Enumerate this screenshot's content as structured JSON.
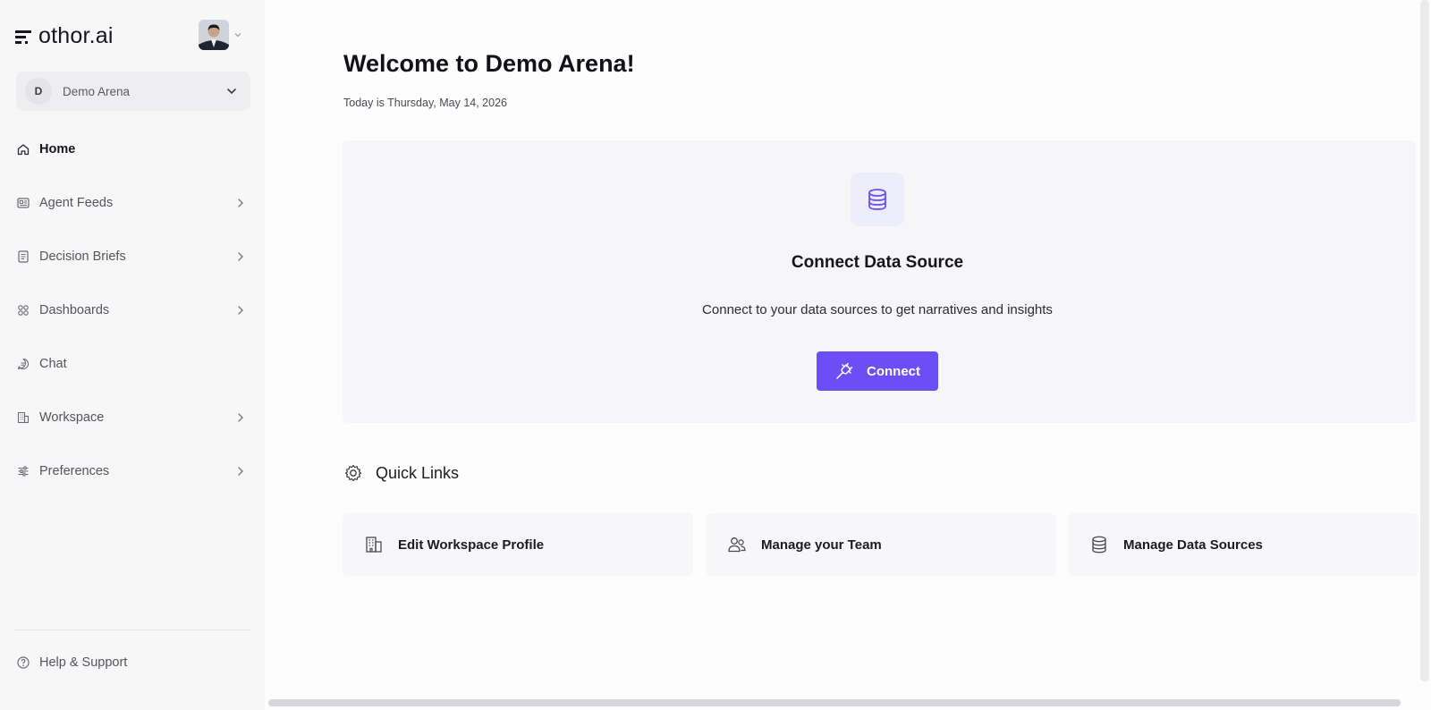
{
  "brand": {
    "name": "othor.ai"
  },
  "workspace": {
    "initial": "D",
    "name": "Demo Arena"
  },
  "nav": {
    "items": [
      {
        "label": "Home",
        "icon": "home-icon",
        "active": true,
        "has_chevron": false
      },
      {
        "label": "Agent Feeds",
        "icon": "feed-icon",
        "has_chevron": true
      },
      {
        "label": "Decision Briefs",
        "icon": "document-icon",
        "has_chevron": true
      },
      {
        "label": "Dashboards",
        "icon": "grid-icon",
        "has_chevron": true
      },
      {
        "label": "Chat",
        "icon": "chat-icon",
        "has_chevron": false
      },
      {
        "label": "Workspace",
        "icon": "building-icon",
        "has_chevron": true
      },
      {
        "label": "Preferences",
        "icon": "sliders-icon",
        "has_chevron": true
      }
    ],
    "help": {
      "label": "Help & Support",
      "icon": "help-icon"
    }
  },
  "main": {
    "title": "Welcome to Demo Arena!",
    "date": "Today is Thursday, May 14, 2026",
    "hero": {
      "icon": "database-icon",
      "title": "Connect Data Source",
      "description": "Connect to your data sources to get narratives and insights",
      "button_label": "Connect",
      "button_icon": "plug-icon"
    },
    "quick_links": {
      "heading": "Quick Links",
      "heading_icon": "gear-icon",
      "items": [
        {
          "label": "Edit Workspace Profile",
          "icon": "building-icon"
        },
        {
          "label": "Manage your Team",
          "icon": "users-icon"
        },
        {
          "label": "Manage Data Sources",
          "icon": "database-icon"
        }
      ]
    }
  },
  "colors": {
    "accent": "#6b4ef6",
    "accent_soft": "#ececfb",
    "sidebar_bg": "#f7f7f8"
  }
}
